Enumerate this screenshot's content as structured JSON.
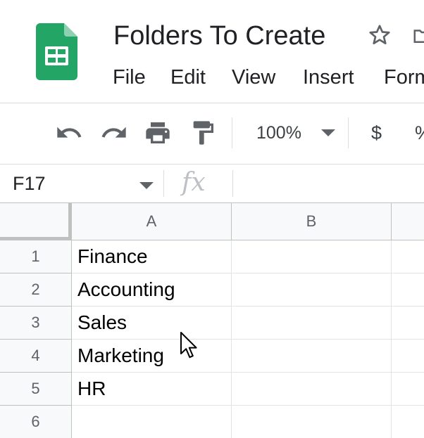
{
  "document": {
    "title": "Folders To Create",
    "menu": [
      "File",
      "Edit",
      "View",
      "Insert",
      "Form"
    ]
  },
  "toolbar": {
    "icons": [
      "undo-icon",
      "redo-icon",
      "print-icon",
      "paint-format-icon"
    ],
    "zoom": "100%",
    "currency_symbol": "$",
    "percent_symbol": "%"
  },
  "formula_bar": {
    "cell_reference": "F17",
    "fx_symbol": "fx",
    "formula_value": ""
  },
  "sheet": {
    "columns": [
      "A",
      "B"
    ],
    "rows": [
      {
        "number": "1",
        "cells": [
          "Finance",
          ""
        ]
      },
      {
        "number": "2",
        "cells": [
          "Accounting",
          ""
        ]
      },
      {
        "number": "3",
        "cells": [
          "Sales",
          ""
        ]
      },
      {
        "number": "4",
        "cells": [
          "Marketing",
          ""
        ]
      },
      {
        "number": "5",
        "cells": [
          "HR",
          ""
        ]
      },
      {
        "number": "6",
        "cells": [
          "",
          ""
        ]
      }
    ]
  },
  "colors": {
    "sheets_green": "#23a566",
    "header_bg": "#f8f9fa",
    "gridline": "#e2e3e3",
    "icon_gray": "#5f6368"
  }
}
